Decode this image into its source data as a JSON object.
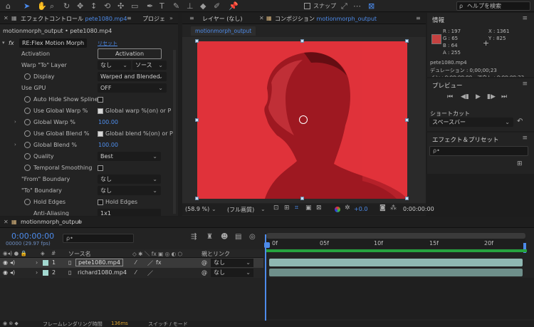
{
  "toolbar": {
    "snap_label": "スナップ",
    "help_placeholder": "ヘルプを検索"
  },
  "effect_controls": {
    "tab_label": "エフェクトコントロール",
    "tab_file": "pete1080.mp4",
    "tab_next": "プロジェ",
    "breadcrumb": "motionmorph_output • pete1080.mp4",
    "effect_name": "RE:Flex Motion Morph",
    "reset_label": "リセット",
    "rows": {
      "activation": "Activation",
      "activation_button": "Activation",
      "warp_to_layer": "Warp \"To\" Layer",
      "warp_to_value": "なし",
      "warp_source_value": "ソース",
      "display": "Display",
      "display_value": "Warped and Blended",
      "use_gpu": "Use GPU",
      "use_gpu_value": "OFF",
      "auto_hide": "Auto Hide Show Splines",
      "use_global_warp": "Use Global Warp %",
      "use_global_warp_chk": "Global warp %(on) or P",
      "global_warp": "Global Warp %",
      "global_warp_value": "100.00",
      "use_global_blend": "Use Global Blend %",
      "use_global_blend_chk": "Global blend %(on) or P",
      "global_blend": "Global Blend %",
      "global_blend_value": "100.00",
      "quality": "Quality",
      "quality_value": "Best",
      "temporal_smoothing": "Temporal Smoothing",
      "from_boundary": "\"From\" Boundary",
      "from_boundary_value": "なし",
      "to_boundary": "\"To\" Boundary",
      "to_boundary_value": "なし",
      "hold_edges": "Hold Edges",
      "hold_edges_chk": "Hold Edges",
      "anti_aliasing": "Anti-Aliasing",
      "anti_aliasing_value": "1x1"
    }
  },
  "composition": {
    "layer_tab": "レイヤー (なし)",
    "comp_tab_label": "コンポジション",
    "comp_tab_name": "motionmorph_output",
    "subtab": "motionmorph_output",
    "zoom": "(58.9 %)",
    "quality": "(フル画質)",
    "exposure": "+0.0",
    "timecode": "0:00:00:00"
  },
  "info": {
    "title": "情報",
    "r": "R : 197",
    "g": "G : 65",
    "b": "B : 64",
    "a": "A : 255",
    "x": "X : 1361",
    "y": "Y : 825",
    "file": "pete1080.mp4",
    "duration": "デュレーション : 0;00;00;23",
    "inout": "イン : 0;00;00;00、アウト : 0;00;00;23",
    "swatch_color": "#c54140"
  },
  "preview": {
    "title": "プレビュー",
    "shortcut_label": "ショートカット",
    "shortcut_value": "スペースバー"
  },
  "effects_presets": {
    "title": "エフェクト＆プリセット",
    "search_placeholder": "ρ•"
  },
  "timeline": {
    "tab_label": "motionmorph_output",
    "timecode": "0:00:00:00",
    "frame_info": "00000 (29.97 fps)",
    "search_placeholder": "ρ•",
    "col_source": "ソース名",
    "col_parent": "親とリンク",
    "ruler": [
      "0f",
      "05f",
      "10f",
      "15f",
      "20f"
    ],
    "layers": [
      {
        "num": "1",
        "name": "pete1080.mp4",
        "parent": "なし"
      },
      {
        "num": "2",
        "name": "richard1080.mp4",
        "parent": "なし"
      }
    ],
    "footer_render": "フレームレンダリング時間",
    "footer_ms": "136ms",
    "footer_switch": "スイッチ / モード"
  }
}
